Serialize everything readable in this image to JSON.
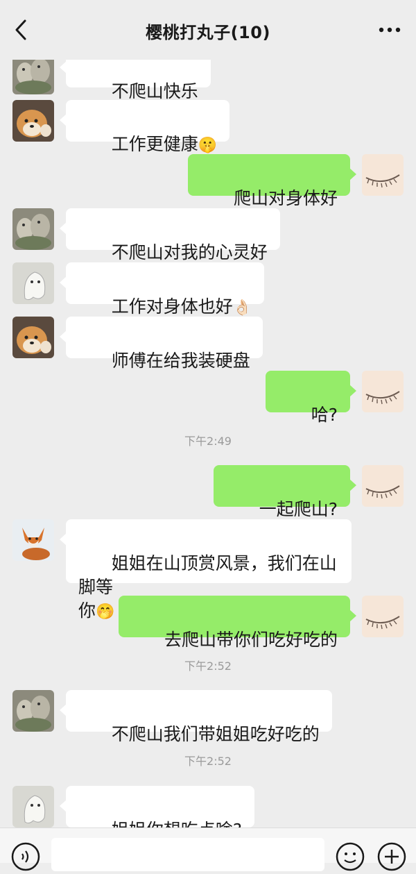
{
  "header": {
    "title": "樱桃打丸子(10)"
  },
  "messages": [
    {
      "side": "left",
      "avatar": "rock-avatar",
      "text": "不爬山快乐"
    },
    {
      "side": "left",
      "avatar": "shiba-avatar",
      "text": "工作更健康",
      "emoji": "🤫"
    },
    {
      "side": "right",
      "avatar": "eye-avatar",
      "text": "爬山对身体好"
    },
    {
      "side": "left",
      "avatar": "rock-avatar",
      "text": "不爬山对我的心灵好"
    },
    {
      "side": "left",
      "avatar": "ghost-avatar",
      "text": "工作对身体也好",
      "emoji": "👌🏻"
    },
    {
      "side": "left",
      "avatar": "shiba-avatar",
      "text": "师傅在给我装硬盘"
    },
    {
      "side": "right",
      "avatar": "eye-avatar",
      "text": "哈?"
    },
    {
      "side": "right",
      "avatar": "eye-avatar",
      "text": "一起爬山?"
    },
    {
      "side": "left",
      "avatar": "fox-avatar",
      "text": "姐姐在山顶赏风景，我们在山脚等\n你",
      "emoji": "🤭"
    },
    {
      "side": "right",
      "avatar": "eye-avatar",
      "text": "去爬山带你们吃好吃的"
    },
    {
      "side": "left",
      "avatar": "rock-avatar",
      "text": "不爬山我们带姐姐吃好吃的"
    },
    {
      "side": "left",
      "avatar": "ghost-avatar",
      "text": "姐姐你想吃点啥?"
    }
  ],
  "timestamps": [
    "下午2:49",
    "下午2:52",
    "下午2:52"
  ],
  "input_bar": {
    "voice_icon": "voice-icon",
    "emoji_icon": "smile-icon",
    "plus_icon": "plus-icon"
  },
  "colors": {
    "background": "#ededed",
    "sent_bubble": "#95ec69",
    "received_bubble": "#ffffff",
    "timestamp_text": "#9a9a9a"
  }
}
